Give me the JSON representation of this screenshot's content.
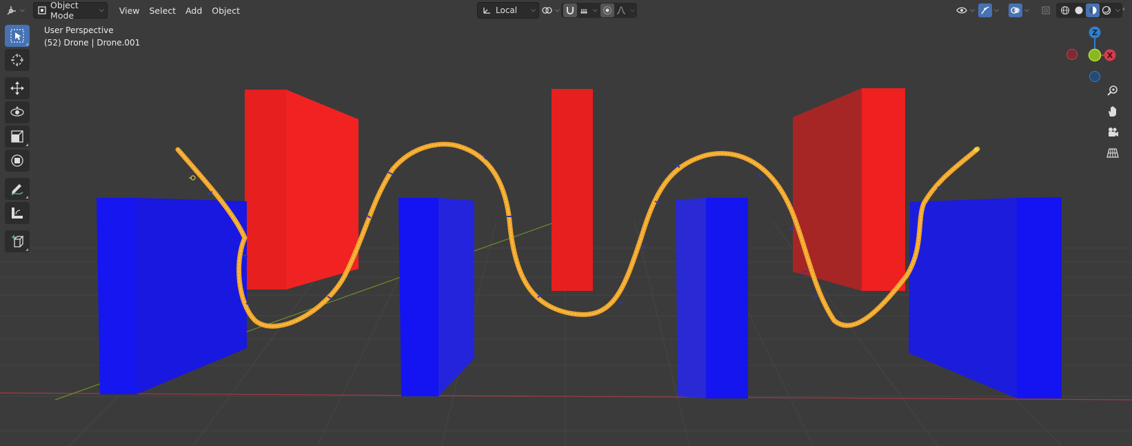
{
  "header": {
    "editor_type_icon": "3d-viewport-icon",
    "mode": "Object Mode",
    "menus": [
      "View",
      "Select",
      "Add",
      "Object"
    ],
    "transform_orientation": "Local"
  },
  "overlay": {
    "view_name": "User Perspective",
    "object_info": "(52) Drone | Drone.001"
  },
  "toolbar": {
    "tools": [
      "select-box",
      "cursor",
      "move",
      "rotate",
      "scale",
      "transform",
      "annotate",
      "measure",
      "add-cube"
    ]
  },
  "gizmo": {
    "axis_z": "Z",
    "axis_x": "X"
  },
  "colors": {
    "viewport_bg": "#3b3b3b",
    "accent": "#4772b3",
    "x_axis": "#d63c4b",
    "y_axis": "#8ab61e",
    "z_axis": "#2e7fd6",
    "red_object": "#ee1f1f",
    "blue_object": "#1515ee",
    "curve": "#f0a52a"
  }
}
